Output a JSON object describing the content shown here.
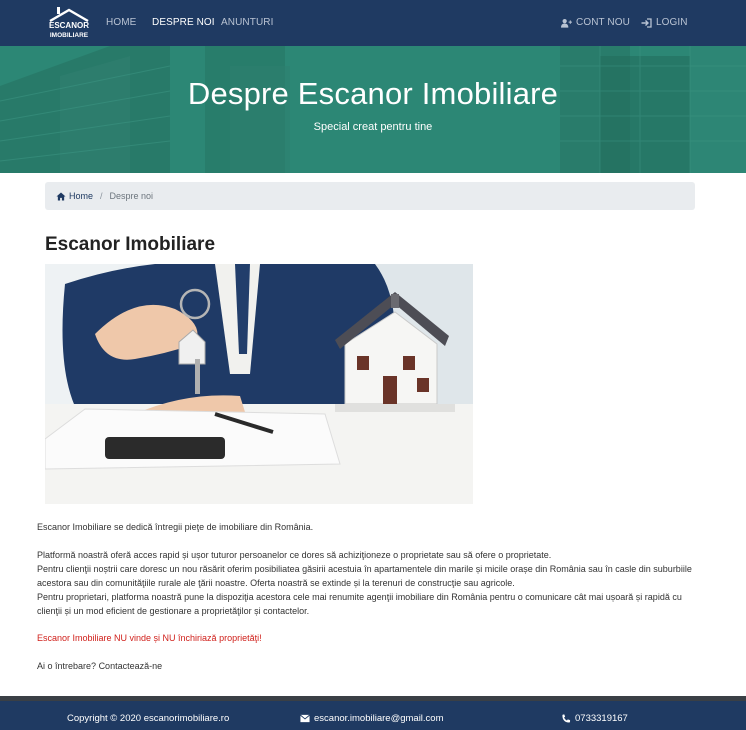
{
  "nav": {
    "logo_text": "ESCANOR IMOBILIARE",
    "links": [
      "HOME",
      "DESPRE NOI",
      "ANUNTURI"
    ],
    "register": "CONT NOU",
    "login": "LOGIN",
    "active": "DESPRE NOI"
  },
  "hero": {
    "title": "Despre Escanor Imobiliare",
    "subtitle": "Special creat pentru tine"
  },
  "breadcrumb": {
    "home": "Home",
    "separator": "/",
    "current": "Despre noi"
  },
  "main": {
    "heading": "Escanor Imobiliare",
    "paragraphs": [
      "Escanor Imobiliare se dedică întregii pieţe de imobiliare din România.",
      "Platformă noastră oferă acces rapid și ușor tuturor persoanelor ce dores să achiziţioneze o proprietate sau să ofere o proprietate.",
      "Pentru clienţii noștrii care doresc un nou răsărit oferim posibiliatea găsirii acestuia în apartamentele din marile și micile orașe din România sau în casle din suburbiile acestora sau din comunităţiile rurale ale ţării noastre. Oferta noastră se extinde și la terenuri de construcţie sau agricole.",
      "Pentru proprietari, platforma noastră pune la dispoziţia acestora cele mai renumite agenţii imobiliare din România pentru o comunicare cât mai ușoară și rapidă cu clienţii și un mod eficient de gestionare a proprietăţilor și contactelor.",
      "Escanor Imobiliare NU vinde și NU închiriază proprietăţi!"
    ],
    "question": "Ai o întrebare?",
    "contact_link": "Contactează-ne"
  },
  "footer": {
    "copyright": "Copyright © 2020 escanorimobiliare.ro",
    "email": "escanor.imobiliare@gmail.com",
    "phone": "0733319167"
  },
  "colors": {
    "navbar": "#1f3a62",
    "hero": "#2f8c79",
    "warning_text": "#d0201b"
  },
  "icons": [
    "user-plus-icon",
    "sign-in-icon",
    "home-icon",
    "envelope-icon",
    "phone-icon"
  ]
}
